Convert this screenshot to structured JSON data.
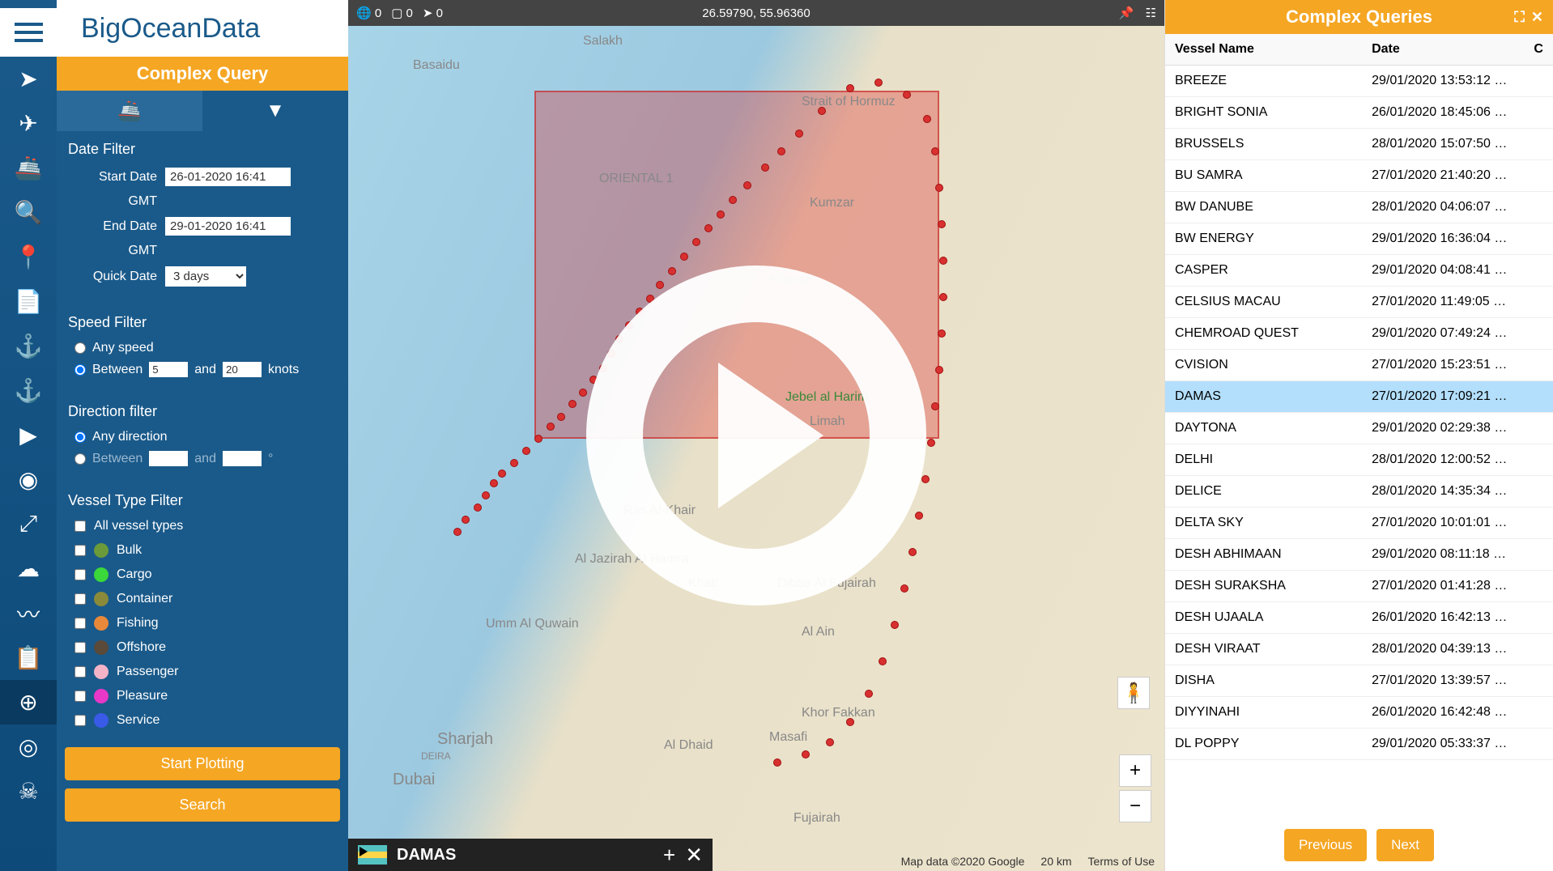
{
  "logo": "BigOceanData",
  "complexQuery": {
    "title": "Complex Query",
    "dateFilter": {
      "heading": "Date Filter",
      "startLabel": "Start Date",
      "startValue": "26-01-2020 16:41",
      "endLabel": "End Date",
      "endValue": "29-01-2020 16:41",
      "gmt": "GMT",
      "quickLabel": "Quick Date",
      "quickValue": "3 days"
    },
    "speedFilter": {
      "heading": "Speed Filter",
      "anyLabel": "Any speed",
      "betweenLabel": "Between",
      "andLabel": "and",
      "minValue": "5",
      "maxValue": "20",
      "unit": "knots"
    },
    "directionFilter": {
      "heading": "Direction filter",
      "anyLabel": "Any direction",
      "betweenLabel": "Between",
      "andLabel": "and",
      "unit": "°"
    },
    "vesselTypeFilter": {
      "heading": "Vessel Type Filter",
      "allLabel": "All vessel types",
      "types": [
        {
          "label": "Bulk",
          "color": "#6a9a3a"
        },
        {
          "label": "Cargo",
          "color": "#3ad83a"
        },
        {
          "label": "Container",
          "color": "#8a8a3a"
        },
        {
          "label": "Fishing",
          "color": "#e8883a"
        },
        {
          "label": "Offshore",
          "color": "#5a4a3a"
        },
        {
          "label": "Passenger",
          "color": "#f5b3c8"
        },
        {
          "label": "Pleasure",
          "color": "#e838c8"
        },
        {
          "label": "Service",
          "color": "#3a5ae8"
        }
      ]
    },
    "buttons": {
      "plot": "Start Plotting",
      "search": "Search"
    }
  },
  "map": {
    "stats": {
      "globe": "0",
      "square": "0",
      "arrow": "0"
    },
    "coords": "26.59790, 55.96360",
    "vesselBar": "DAMAS",
    "footer": {
      "attribution": "Map data ©2020 Google",
      "scale": "20 km",
      "terms": "Terms of Use"
    },
    "labels": {
      "oriental": "ORIENTAL 1",
      "hormuz": "Strait of Hormuz",
      "kumzar": "Kumzar",
      "khasab": "Khasab",
      "jebel": "Jebel al Harim",
      "limah": "Limah",
      "rasalkhair": "Ras Al-Khair",
      "jazirah": "Al Jazirah Al Hamra",
      "khatt": "Khatt",
      "dibba": "Dibba Al Fujairah",
      "ummq": "Umm Al Quwain",
      "sharjah": "Sharjah",
      "dubai": "Dubai",
      "aldhaid": "Al Dhaid",
      "masafi": "Masafi",
      "fujairah": "Fujairah",
      "khorfakkan": "Khor Fakkan",
      "basaidu": "Basaidu",
      "salakh": "Salakh",
      "alain": "Al Ain",
      "deira": "DEIRA"
    }
  },
  "resultsPanel": {
    "title": "Complex Queries",
    "columns": {
      "name": "Vessel Name",
      "date": "Date",
      "c": "C"
    },
    "rows": [
      {
        "name": "BREEZE",
        "date": "29/01/2020 13:53:12 …"
      },
      {
        "name": "BRIGHT SONIA",
        "date": "26/01/2020 18:45:06 …"
      },
      {
        "name": "BRUSSELS",
        "date": "28/01/2020 15:07:50 …"
      },
      {
        "name": "BU SAMRA",
        "date": "27/01/2020 21:40:20 …"
      },
      {
        "name": "BW DANUBE",
        "date": "28/01/2020 04:06:07 …"
      },
      {
        "name": "BW ENERGY",
        "date": "29/01/2020 16:36:04 …"
      },
      {
        "name": "CASPER",
        "date": "29/01/2020 04:08:41 …"
      },
      {
        "name": "CELSIUS MACAU",
        "date": "27/01/2020 11:49:05 …"
      },
      {
        "name": "CHEMROAD QUEST",
        "date": "29/01/2020 07:49:24 …"
      },
      {
        "name": "CVISION",
        "date": "27/01/2020 15:23:51 …"
      },
      {
        "name": "DAMAS",
        "date": "27/01/2020 17:09:21 …",
        "selected": true
      },
      {
        "name": "DAYTONA",
        "date": "29/01/2020 02:29:38 …"
      },
      {
        "name": "DELHI",
        "date": "28/01/2020 12:00:52 …"
      },
      {
        "name": "DELICE",
        "date": "28/01/2020 14:35:34 …"
      },
      {
        "name": "DELTA SKY",
        "date": "27/01/2020 10:01:01 …"
      },
      {
        "name": "DESH ABHIMAAN",
        "date": "29/01/2020 08:11:18 …"
      },
      {
        "name": "DESH SURAKSHA",
        "date": "27/01/2020 01:41:28 …"
      },
      {
        "name": "DESH UJAALA",
        "date": "26/01/2020 16:42:13 …"
      },
      {
        "name": "DESH VIRAAT",
        "date": "28/01/2020 04:39:13 …"
      },
      {
        "name": "DISHA",
        "date": "27/01/2020 13:39:57 …"
      },
      {
        "name": "DIYYINAHI",
        "date": "26/01/2020 16:42:48 …"
      },
      {
        "name": "DL POPPY",
        "date": "29/01/2020 05:33:37 …"
      }
    ],
    "prev": "Previous",
    "next": "Next"
  }
}
